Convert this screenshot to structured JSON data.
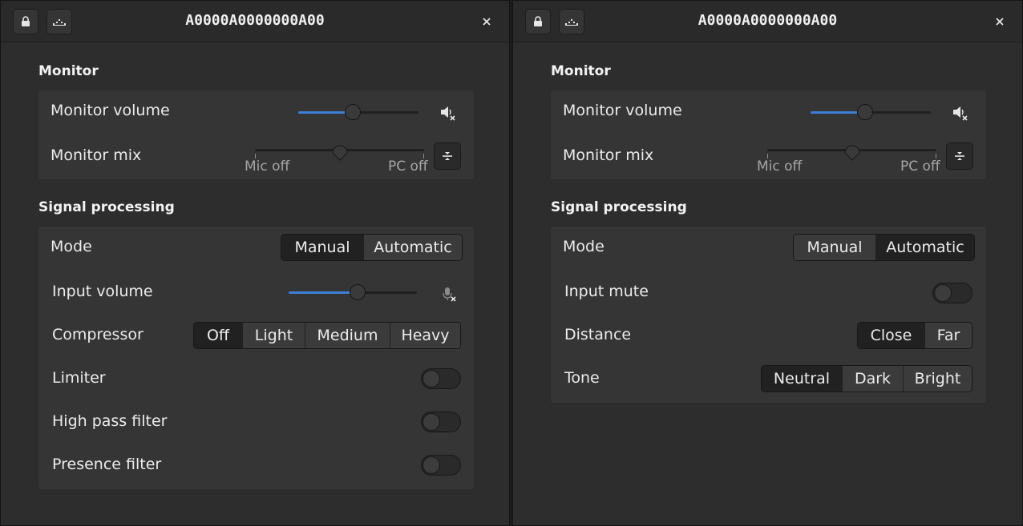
{
  "windows": [
    {
      "title": "A0000A0000000A00",
      "monitor": {
        "section_title": "Monitor",
        "volume_label": "Monitor volume",
        "volume_level": 0.45,
        "mix_label": "Monitor mix",
        "mix_level": 0.5,
        "mix_left": "Mic off",
        "mix_right": "PC off"
      },
      "signal": {
        "section_title": "Signal processing",
        "mode_label": "Mode",
        "mode_options": [
          "Manual",
          "Automatic"
        ],
        "mode_selected": "Manual",
        "input_volume_label": "Input volume",
        "input_volume_level": 0.54,
        "compressor_label": "Compressor",
        "compressor_options": [
          "Off",
          "Light",
          "Medium",
          "Heavy"
        ],
        "compressor_selected": "Off",
        "limiter_label": "Limiter",
        "limiter_on": false,
        "hpf_label": "High pass filter",
        "hpf_on": false,
        "presence_label": "Presence filter",
        "presence_on": false
      }
    },
    {
      "title": "A0000A0000000A00",
      "monitor": {
        "section_title": "Monitor",
        "volume_label": "Monitor volume",
        "volume_level": 0.45,
        "mix_label": "Monitor mix",
        "mix_level": 0.5,
        "mix_left": "Mic off",
        "mix_right": "PC off"
      },
      "signal": {
        "section_title": "Signal processing",
        "mode_label": "Mode",
        "mode_options": [
          "Manual",
          "Automatic"
        ],
        "mode_selected": "Automatic",
        "input_mute_label": "Input mute",
        "input_mute_on": false,
        "distance_label": "Distance",
        "distance_options": [
          "Close",
          "Far"
        ],
        "distance_selected": "Close",
        "tone_label": "Tone",
        "tone_options": [
          "Neutral",
          "Dark",
          "Bright"
        ],
        "tone_selected": "Neutral"
      }
    }
  ],
  "icons": {
    "lock": "lock-icon",
    "eq": "equalizer-icon",
    "close": "close-icon",
    "speaker": "speaker-muted-icon",
    "mic": "microphone-muted-icon",
    "mix": "mix-icon"
  },
  "colors": {
    "accent": "#3d7fd6",
    "window_bg": "#2d2d2d",
    "card_bg": "#353535"
  }
}
